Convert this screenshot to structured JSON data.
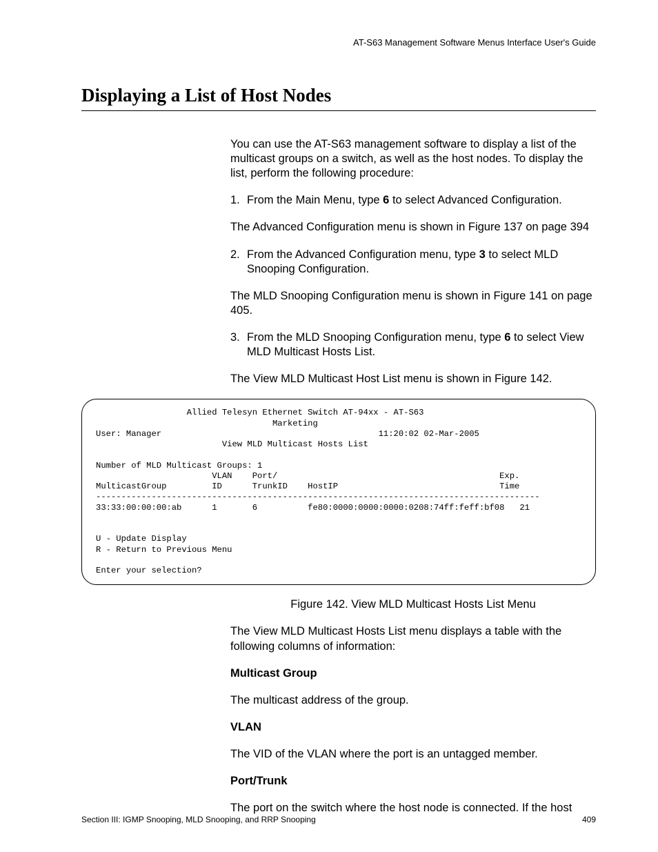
{
  "header": "AT-S63 Management Software Menus Interface User's Guide",
  "title": "Displaying a List of Host Nodes",
  "intro": "You can use the AT-S63 management software to display a list of the multicast groups on a switch, as well as the host nodes. To display the list, perform the following procedure:",
  "steps": [
    {
      "n": "1.",
      "pre": "From the Main Menu, type ",
      "bold": "6",
      "post": " to select Advanced Configuration.",
      "sub": "The Advanced Configuration menu is shown in Figure 137 on page 394"
    },
    {
      "n": "2.",
      "pre": "From the Advanced Configuration menu, type ",
      "bold": "3",
      "post": " to select MLD Snooping Configuration.",
      "sub": "The MLD Snooping Configuration menu is shown in Figure 141 on page 405."
    },
    {
      "n": "3.",
      "pre": "From the MLD Snooping Configuration menu, type ",
      "bold": "6",
      "post": " to select View MLD Multicast Hosts List.",
      "sub": "The View MLD Multicast Host List menu is shown in Figure 142."
    }
  ],
  "terminal": {
    "title_line": "                  Allied Telesyn Ethernet Switch AT-94xx - AT-S63",
    "subtitle": "                                   Marketing",
    "user_line": "User: Manager                                           11:20:02 02-Mar-2005",
    "view_title": "                         View MLD Multicast Hosts List",
    "blank": "",
    "count_line": "Number of MLD Multicast Groups: 1",
    "hdr1": "                       VLAN    Port/                                            Exp.",
    "hdr2": "MulticastGroup         ID      TrunkID    HostIP                                Time",
    "divider": "----------------------------------------------------------------------------------------",
    "row": "33:33:00:00:00:ab      1       6          fe80:0000:0000:0000:0208:74ff:feff:bf08   21",
    "opt1": "U - Update Display",
    "opt2": "R - Return to Previous Menu",
    "prompt": "Enter your selection?"
  },
  "fig_caption": "Figure 142. View MLD Multicast Hosts List Menu",
  "after_fig": "The View MLD Multicast Hosts List menu displays a table with the following columns of information:",
  "defs": [
    {
      "term": "Multicast Group",
      "desc": "The multicast address of the group."
    },
    {
      "term": "VLAN",
      "desc": "The VID of the VLAN where the port is an untagged member."
    },
    {
      "term": "Port/Trunk",
      "desc": "The port on the switch where the host node is connected. If the host"
    }
  ],
  "footer_left": "Section III: IGMP Snooping, MLD Snooping, and RRP Snooping",
  "footer_right": "409"
}
